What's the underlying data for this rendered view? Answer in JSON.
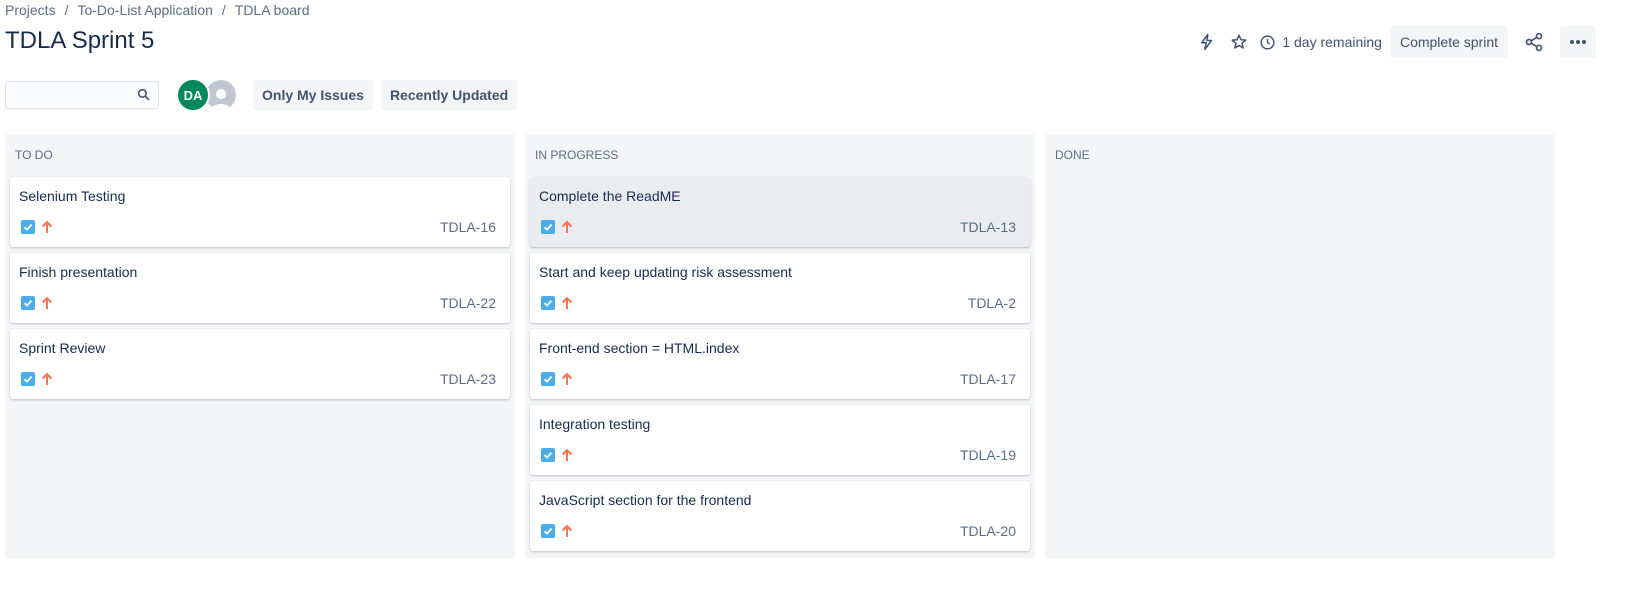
{
  "breadcrumbs": [
    "Projects",
    "To-Do-List Application",
    "TDLA board"
  ],
  "page_title": "TDLA Sprint 5",
  "header": {
    "remaining": "1 day remaining",
    "complete_label": "Complete sprint"
  },
  "toolbar": {
    "search_value": "",
    "avatar_initials": "DA",
    "filters": [
      "Only My Issues",
      "Recently Updated"
    ]
  },
  "colors": {
    "story_type": "#4bade8",
    "priority_high": "#ff7452",
    "avatar_green": "#00875a"
  },
  "columns": [
    {
      "title": "TO DO",
      "cards": [
        {
          "summary": "Selenium Testing",
          "key": "TDLA-16"
        },
        {
          "summary": "Finish presentation",
          "key": "TDLA-22"
        },
        {
          "summary": "Sprint Review",
          "key": "TDLA-23"
        }
      ]
    },
    {
      "title": "IN PROGRESS",
      "cards": [
        {
          "summary": "Complete the ReadME",
          "key": "TDLA-13"
        },
        {
          "summary": "Start and keep updating risk assessment",
          "key": "TDLA-2"
        },
        {
          "summary": "Front-end section = HTML.index",
          "key": "TDLA-17"
        },
        {
          "summary": "Integration testing",
          "key": "TDLA-19"
        },
        {
          "summary": "JavaScript section for the frontend",
          "key": "TDLA-20"
        }
      ]
    },
    {
      "title": "DONE",
      "cards": []
    }
  ]
}
